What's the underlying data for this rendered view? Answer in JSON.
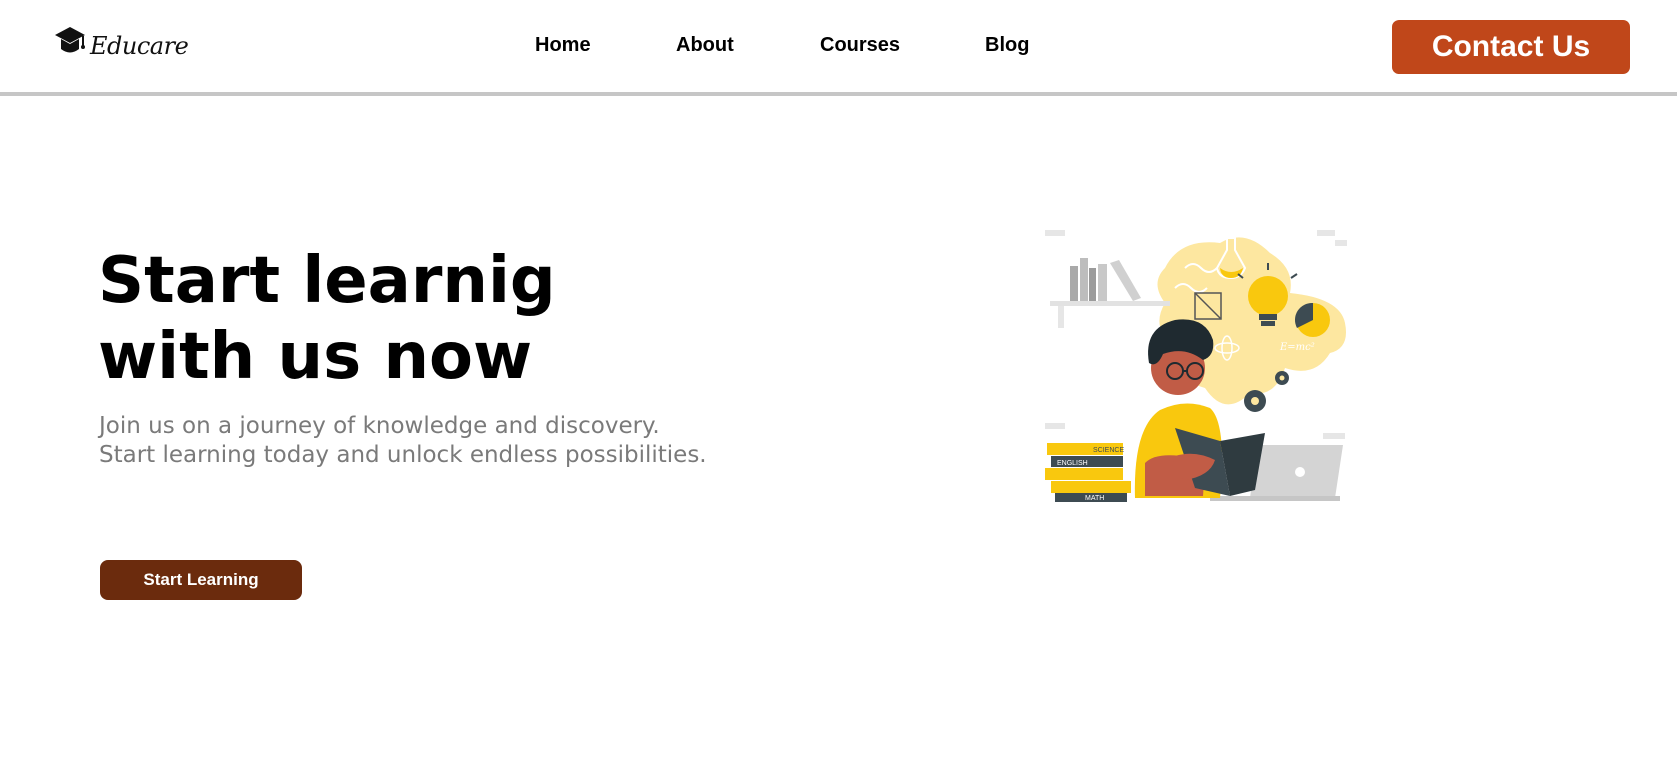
{
  "brand": {
    "name": "Educare",
    "logo_icon": "graduation-cap-icon"
  },
  "nav": {
    "items": [
      {
        "label": "Home"
      },
      {
        "label": "About"
      },
      {
        "label": "Courses"
      },
      {
        "label": "Blog"
      }
    ],
    "contact_label": "Contact Us"
  },
  "hero": {
    "title_line1": "Start learnig",
    "title_line2": "with us now",
    "description": "Join us on a journey of knowledge and discovery. Start learning today and unlock endless possibilities.",
    "cta_label": "Start Learning",
    "illustration": {
      "book_labels": [
        "SCIENCE",
        "ENGLISH",
        "MATH"
      ],
      "formula": "E=mc²"
    }
  },
  "colors": {
    "contact_button": "#c0471a",
    "cta_button": "#6b2b0d",
    "accent_yellow": "#f9c80e",
    "navbar_border": "#c6c6c6"
  }
}
